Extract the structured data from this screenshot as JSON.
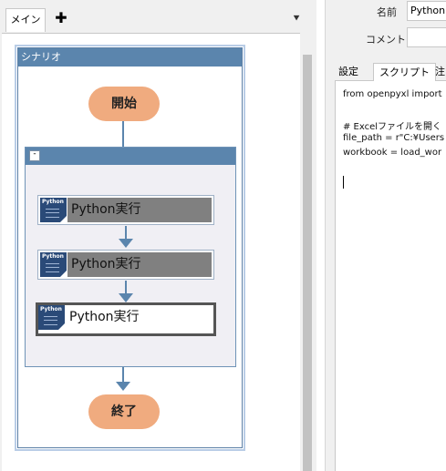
{
  "tabs": {
    "main_label": "メイン",
    "add_label": "✚",
    "overflow_label": "⯆"
  },
  "scenario": {
    "title": "シナリオ"
  },
  "nodes": {
    "start_label": "開始",
    "end_label": "終了"
  },
  "group": {
    "collapse_label": "-"
  },
  "actions": [
    {
      "label": "Python実行",
      "icon_text": "Python"
    },
    {
      "label": "Python実行",
      "icon_text": "Python"
    },
    {
      "label": "Python実行",
      "icon_text": "Python"
    }
  ],
  "properties": {
    "name_label": "名前",
    "name_value": "Python",
    "comment_label": "コメント",
    "comment_value": ""
  },
  "prop_tabs": {
    "settings": "設定",
    "script": "スクリプト",
    "note": "注"
  },
  "script_lines": [
    "from openpyxl import",
    "",
    "# Excelファイルを開く",
    "file_path = r\"C:¥Users",
    "workbook = load_wor"
  ],
  "colors": {
    "header_blue": "#5b85ad",
    "terminal_orange": "#f0ab7f",
    "python_icon": "#2a4a78"
  }
}
